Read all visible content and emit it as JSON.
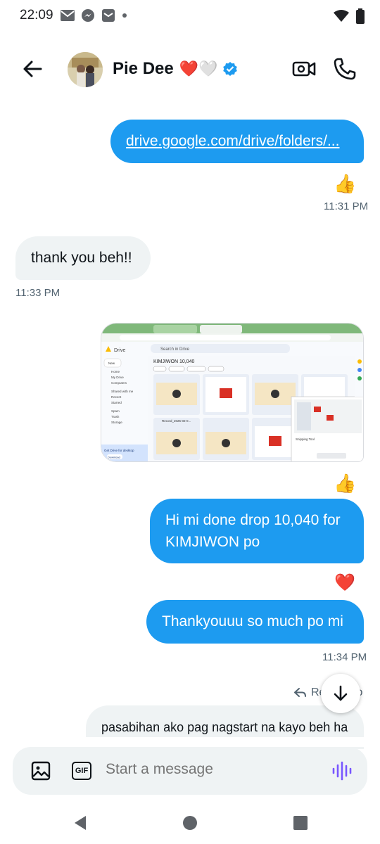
{
  "status": {
    "time": "22:09"
  },
  "header": {
    "contact_name": "Pie Dee",
    "name_emoji": "❤️🤍"
  },
  "messages": {
    "m1_link": "drive.google.com/drive/folders/...",
    "m1_reaction": "👍",
    "m1_time": "11:31 PM",
    "m2_text": "thank you beh!!",
    "m2_time": "11:33 PM",
    "m3_reaction": "👍",
    "m4_text": "Hi mi done drop 10,040 for KIMJIWON po",
    "m4_reaction": "❤️",
    "m5_text": "Thankyouuu so much po mi",
    "m5_time": "11:34 PM",
    "reply_label": "Re",
    "reply_suffix": "o",
    "m6_text": "pasabihan ako pag nagstart na kayo beh ha"
  },
  "screenshot": {
    "folder_title": "KIMJIWON 10,040",
    "search_text": "Search in Drive",
    "app_label": "Drive",
    "new_label": "New",
    "sidebar": [
      "Home",
      "My Drive",
      "Computers",
      "Shared with me",
      "Recent",
      "Starred",
      "Spam",
      "Trash",
      "Storage"
    ],
    "filters": [
      "Type",
      "People",
      "Modified",
      "Source"
    ],
    "desktop_promo": "Get Drive for desktop",
    "download": "Download",
    "snipping_title": "Snipping Tool",
    "file_label": "Record_2025-02-0..."
  },
  "composer": {
    "placeholder": "Start a message",
    "gif_label": "GIF"
  },
  "colors": {
    "accent": "#1d9bf0",
    "incoming": "#eff3f4",
    "verified": "#1d9bf0"
  }
}
